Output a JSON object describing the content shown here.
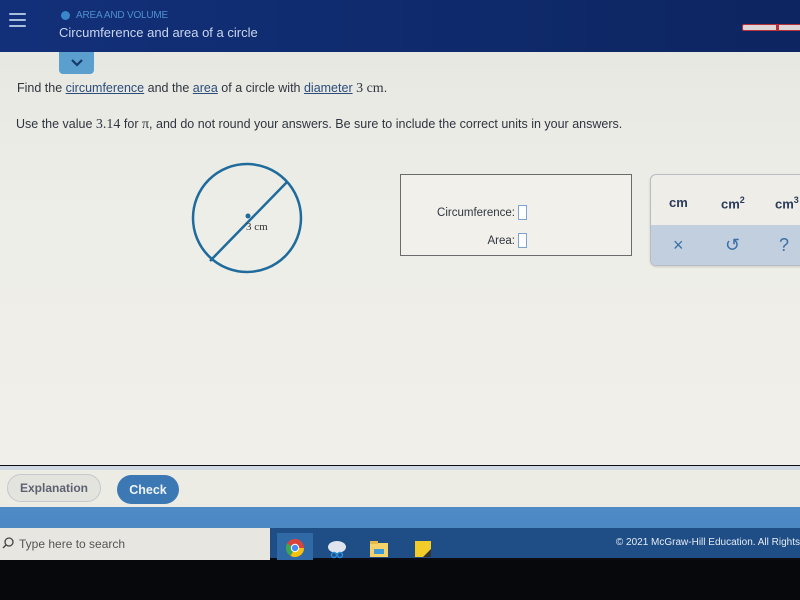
{
  "header": {
    "topic": "AREA AND VOLUME",
    "title": "Circumference and area of a circle",
    "progress_segments": 2
  },
  "question": {
    "line1": {
      "p1": "Find the ",
      "link1": "circumference",
      "p2": " and the ",
      "link2": "area",
      "p3": " of a circle with ",
      "link3": "diameter",
      "p4": " ",
      "value": "3 cm",
      "p5": "."
    },
    "line2": {
      "p1": "Use the value ",
      "pi_value": "3.14",
      "p2": " for ",
      "pi": "π",
      "p3": ", and do not round your answers. Be sure to include the correct units in your answers."
    }
  },
  "figure": {
    "label": "3 cm",
    "colors": {
      "stroke": "#1e6b9c"
    }
  },
  "answers": {
    "circumference_label": "Circumference:",
    "circumference_value": "",
    "area_label": "Area:",
    "area_value": ""
  },
  "keypad": {
    "units": [
      {
        "base": "cm",
        "exp": ""
      },
      {
        "base": "cm",
        "exp": "2"
      },
      {
        "base": "cm",
        "exp": "3"
      }
    ],
    "actions": {
      "clear": "×",
      "undo": "↺",
      "help": "?"
    }
  },
  "buttons": {
    "explanation": "Explanation",
    "check": "Check"
  },
  "footer": {
    "copyright": "© 2021 McGraw-Hill Education. All Rights"
  },
  "taskbar": {
    "search_placeholder": "Type here to search",
    "apps": [
      "chrome-icon",
      "snipping-tool-icon",
      "file-explorer-icon",
      "sticky-notes-icon"
    ]
  },
  "colors": {
    "header_bg": "#12307a",
    "accent": "#3c79b4",
    "footer_bar": "#4e8bc6"
  }
}
